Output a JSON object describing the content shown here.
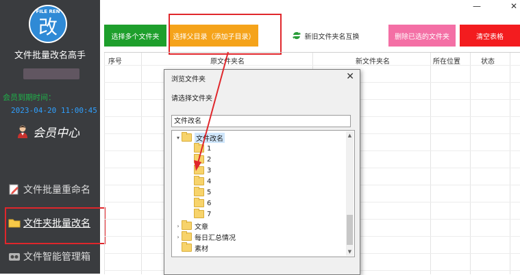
{
  "app": {
    "logo_text": "FILE REN",
    "logo_char": "改",
    "title": "文件批量改名高手",
    "member_label": "会员到期时间：",
    "member_date": "2023-04-20 11:00:45",
    "member_center": "会员中心"
  },
  "sidebar": {
    "items": [
      {
        "icon": "rename-icon",
        "label": "文件批量重命名"
      },
      {
        "icon": "folder-icon",
        "label": "文件夹批量改名"
      },
      {
        "icon": "manage-icon",
        "label": "文件智能管理箱"
      }
    ]
  },
  "toolbar": {
    "select_multi": "选择多个文件夹",
    "select_parent": "选择父目录（添加子目录）",
    "swap_names": "新旧文件夹名互换",
    "delete_selected": "删除已选的文件夹",
    "clear_table": "清空表格"
  },
  "colors": {
    "green": "#1e9f2c",
    "orange": "#f5a31a",
    "pink": "#f46fa5",
    "red": "#f31c1f",
    "sidebar_bg": "#3a3c3f",
    "annotation_red": "#e0262b"
  },
  "table": {
    "headers": [
      "序号",
      "原文件夹名",
      "新文件夹名",
      "所在位置",
      "状态"
    ]
  },
  "window": {
    "minimize": "—",
    "close": "✕"
  },
  "dialog": {
    "title": "浏览文件夹",
    "close": "✕",
    "prompt": "请选择文件夹",
    "path_value": "文件改名",
    "tree": [
      {
        "label": "文件改名",
        "level": 0,
        "expander": "▾",
        "selected": true
      },
      {
        "label": "1",
        "level": 1,
        "expander": ""
      },
      {
        "label": "2",
        "level": 1,
        "expander": ""
      },
      {
        "label": "3",
        "level": 1,
        "expander": ""
      },
      {
        "label": "4",
        "level": 1,
        "expander": ""
      },
      {
        "label": "5",
        "level": 1,
        "expander": ""
      },
      {
        "label": "6",
        "level": 1,
        "expander": ""
      },
      {
        "label": "7",
        "level": 1,
        "expander": ""
      },
      {
        "label": "文章",
        "level": 0,
        "expander": "›"
      },
      {
        "label": "每日汇总情况",
        "level": 0,
        "expander": "›"
      },
      {
        "label": "素材",
        "level": 0,
        "expander": ""
      }
    ]
  }
}
